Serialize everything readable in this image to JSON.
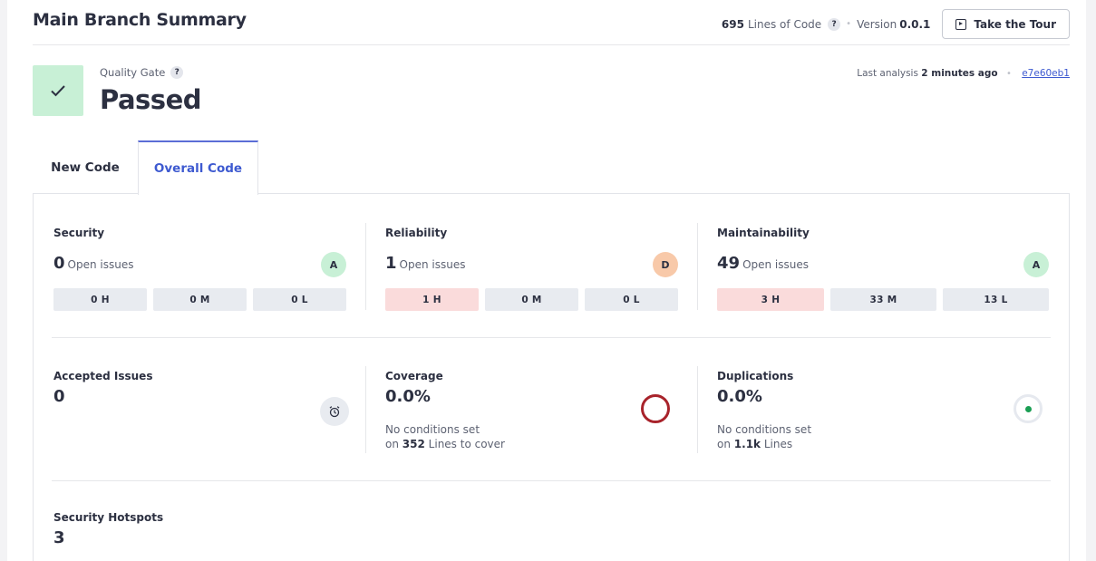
{
  "header": {
    "title": "Main Branch Summary",
    "loc_value": "695",
    "loc_label": "Lines of Code",
    "help_glyph": "?",
    "separator": "•",
    "version_label": "Version",
    "version_value": "0.0.1",
    "tour_label": "Take the Tour"
  },
  "quality_gate": {
    "label": "Quality Gate",
    "status": "Passed",
    "check_glyph": "✓",
    "last_analysis_label": "Last analysis",
    "last_analysis_value": "2 minutes ago",
    "commit": "e7e60eb1"
  },
  "tabs": [
    {
      "label": "New Code",
      "active": false
    },
    {
      "label": "Overall Code",
      "active": true
    }
  ],
  "metrics": {
    "security": {
      "label": "Security",
      "value": "0",
      "sub": "Open issues",
      "grade": "A",
      "chips": [
        "0 H",
        "0 M",
        "0 L"
      ]
    },
    "reliability": {
      "label": "Reliability",
      "value": "1",
      "sub": "Open issues",
      "grade": "D",
      "chips": [
        "1 H",
        "0 M",
        "0 L"
      ]
    },
    "maintainability": {
      "label": "Maintainability",
      "value": "49",
      "sub": "Open issues",
      "grade": "A",
      "chips": [
        "3 H",
        "33 M",
        "13 L"
      ]
    },
    "accepted": {
      "label": "Accepted Issues",
      "value": "0"
    },
    "coverage": {
      "label": "Coverage",
      "value": "0.0%",
      "note_line1": "No conditions set",
      "note_prefix": "on",
      "note_num": "352",
      "note_suffix": "Lines to cover"
    },
    "duplications": {
      "label": "Duplications",
      "value": "0.0%",
      "note_line1": "No conditions set",
      "note_prefix": "on",
      "note_num": "1.1k",
      "note_suffix": "Lines"
    },
    "hotspots": {
      "label": "Security Hotspots",
      "value": "3"
    }
  },
  "colors": {
    "accent": "#3e5ad0",
    "passed_bg": "#c8f0d6",
    "grade_a": "#c8f0d6",
    "grade_d": "#f8c9a9",
    "high_chip": "#fadbdb",
    "coverage_ring": "#a8232b",
    "duplication_dot": "#1a9e53"
  },
  "icons": {
    "passed": "check-icon",
    "tour": "play-square-icon",
    "accepted": "alarm-clock-icon",
    "coverage": "coverage-ring-icon",
    "duplications": "duplication-ring-icon"
  }
}
